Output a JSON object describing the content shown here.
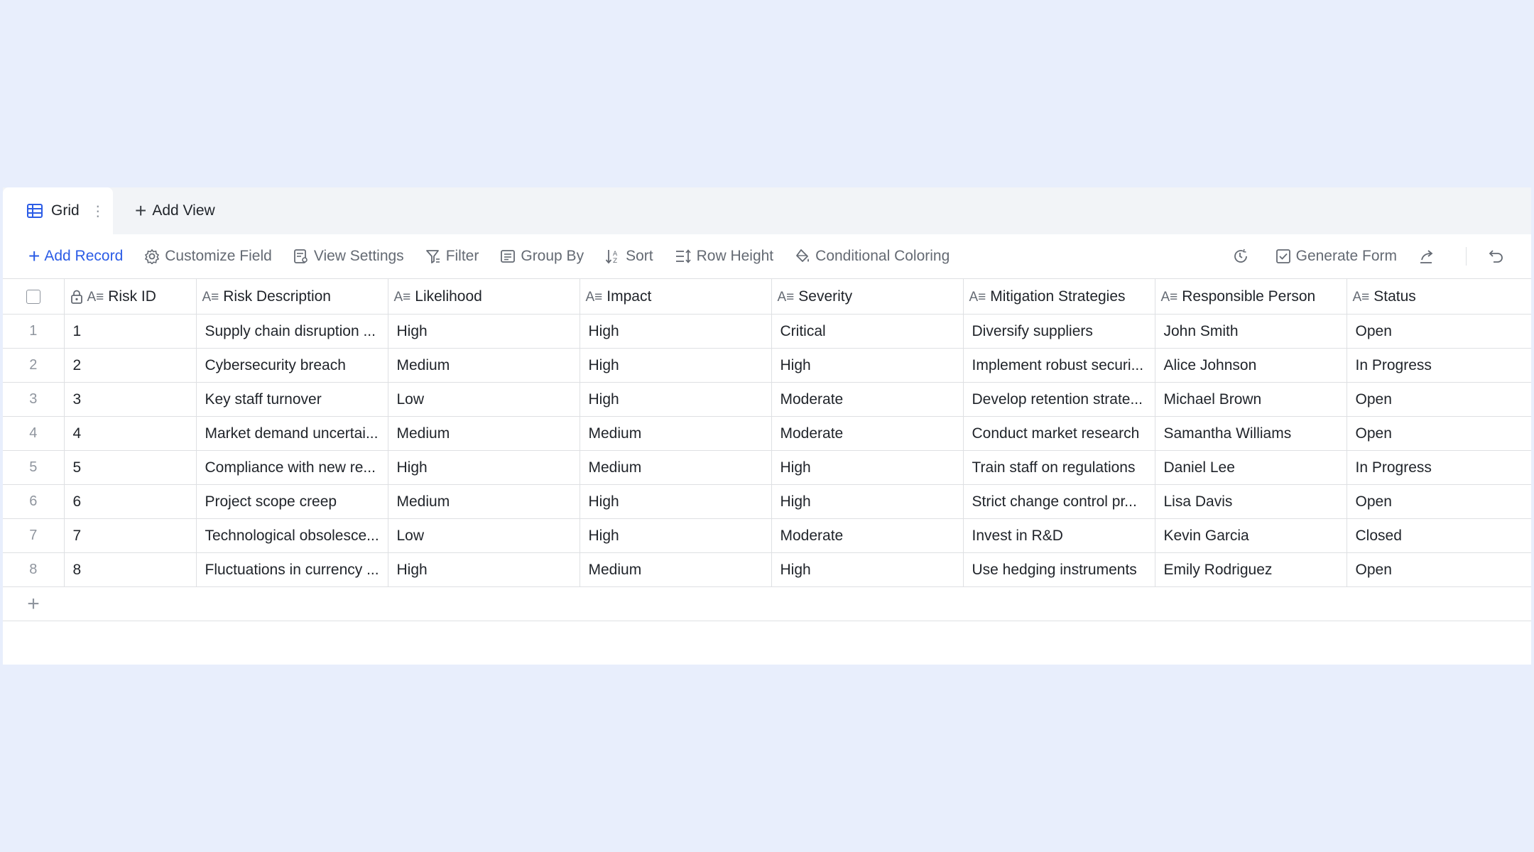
{
  "tabs": {
    "active_label": "Grid",
    "add_view_label": "Add View"
  },
  "toolbar": {
    "add_record": "Add Record",
    "customize_field": "Customize Field",
    "view_settings": "View Settings",
    "filter": "Filter",
    "group_by": "Group By",
    "sort": "Sort",
    "row_height": "Row Height",
    "conditional_coloring": "Conditional Coloring",
    "generate_form": "Generate Form"
  },
  "colors": {
    "accent": "#2b5ce6",
    "background": "#e8eefc"
  },
  "table": {
    "columns": [
      "Risk ID",
      "Risk Description",
      "Likelihood",
      "Impact",
      "Severity",
      "Mitigation Strategies",
      "Responsible Person",
      "Status"
    ],
    "rows": [
      {
        "num": "1",
        "cells": [
          "1",
          "Supply chain disruption ...",
          "High",
          "High",
          "Critical",
          "Diversify suppliers",
          "John Smith",
          "Open"
        ]
      },
      {
        "num": "2",
        "cells": [
          "2",
          "Cybersecurity breach",
          "Medium",
          "High",
          "High",
          "Implement robust securi...",
          "Alice Johnson",
          "In Progress"
        ]
      },
      {
        "num": "3",
        "cells": [
          "3",
          "Key staff turnover",
          "Low",
          "High",
          "Moderate",
          "Develop retention strate...",
          "Michael Brown",
          "Open"
        ]
      },
      {
        "num": "4",
        "cells": [
          "4",
          "Market demand uncertai...",
          "Medium",
          "Medium",
          "Moderate",
          "Conduct market research",
          "Samantha Williams",
          "Open"
        ]
      },
      {
        "num": "5",
        "cells": [
          "5",
          "Compliance with new re...",
          "High",
          "Medium",
          "High",
          "Train staff on regulations",
          "Daniel Lee",
          "In Progress"
        ]
      },
      {
        "num": "6",
        "cells": [
          "6",
          "Project scope creep",
          "Medium",
          "High",
          "High",
          "Strict change control pr...",
          "Lisa Davis",
          "Open"
        ]
      },
      {
        "num": "7",
        "cells": [
          "7",
          "Technological obsolesce...",
          "Low",
          "High",
          "Moderate",
          "Invest in R&D",
          "Kevin Garcia",
          "Closed"
        ]
      },
      {
        "num": "8",
        "cells": [
          "8",
          "Fluctuations in currency ...",
          "High",
          "Medium",
          "High",
          "Use hedging instruments",
          "Emily Rodriguez",
          "Open"
        ]
      }
    ]
  }
}
